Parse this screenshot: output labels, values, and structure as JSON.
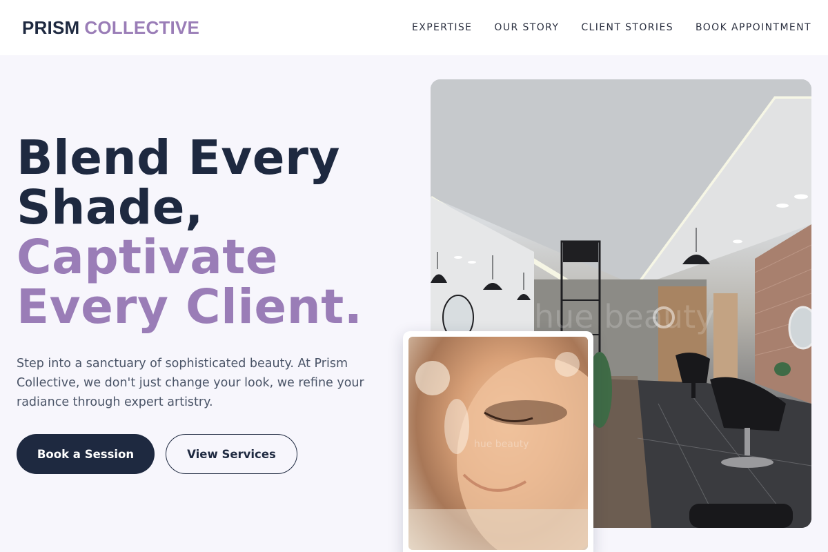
{
  "brand": {
    "name_primary": "PRISM",
    "name_accent": "COLLECTIVE"
  },
  "nav": {
    "items": [
      {
        "label": "EXPERTISE"
      },
      {
        "label": "OUR STORY"
      },
      {
        "label": "CLIENT STORIES"
      },
      {
        "label": "BOOK APPOINTMENT"
      }
    ]
  },
  "hero": {
    "headline_line1": "Blend Every",
    "headline_line2": "Shade,",
    "headline_line3": "Captivate",
    "headline_line4": "Every Client.",
    "description": "Step into a sanctuary of sophisticated beauty. At Prism Collective, we don't just change your look, we refine your radiance through expert artistry.",
    "primary_cta": "Book a Session",
    "secondary_cta": "View Services"
  },
  "colors": {
    "navy": "#1e2940",
    "accent_purple": "#9a7db7",
    "background": "#f7f6fc"
  },
  "images": {
    "main": "salon-interior-photo",
    "inset": "woman-closeup-makeup-photo"
  }
}
